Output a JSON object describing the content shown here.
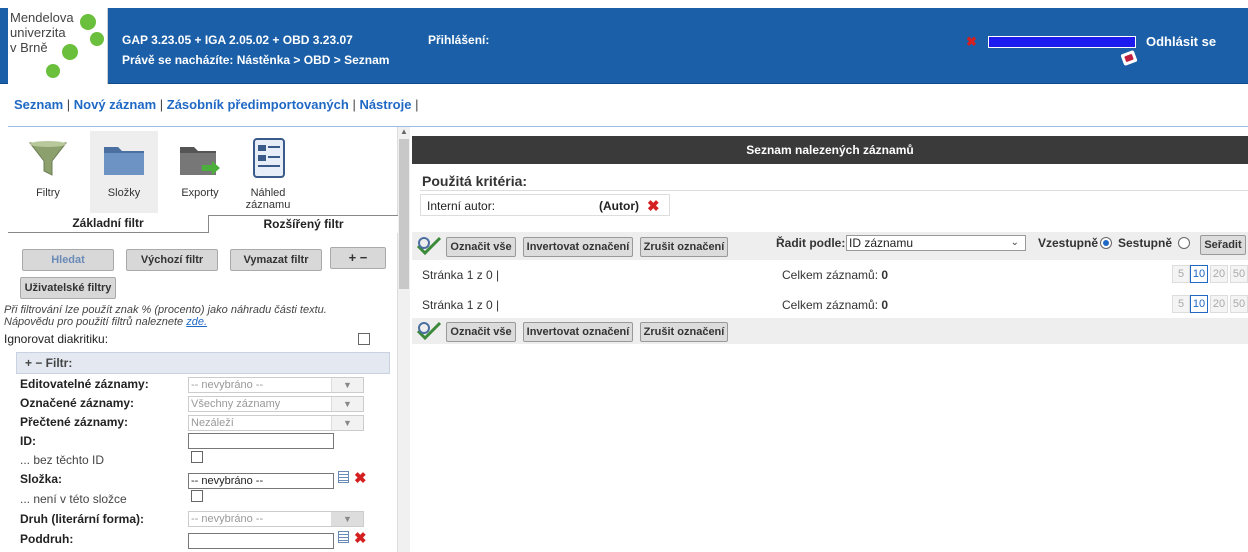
{
  "logo": {
    "lines": [
      "Mendelova",
      "univerzita",
      "v Brně"
    ]
  },
  "header": {
    "version": "GAP 3.23.05 + IGA 2.05.02 + OBD 3.23.07",
    "location": "Právě se nacházíte: Nástěnka >  OBD > Seznam",
    "login_label": "Přihlášení:",
    "logout": "Odhlásit se"
  },
  "nav": {
    "items": [
      "Seznam",
      "Nový záznam",
      "Zásobník předimportovaných",
      "Nástroje"
    ]
  },
  "tools": [
    {
      "label": "Filtry",
      "icon": "funnel-icon"
    },
    {
      "label": "Složky",
      "icon": "folder-icon"
    },
    {
      "label": "Exporty",
      "icon": "export-folder-icon"
    },
    {
      "label": "Náhled záznamu",
      "icon": "document-preview-icon"
    }
  ],
  "tabs": {
    "basic": "Základní filtr",
    "advanced": "Rozšířený filtr"
  },
  "buttons": {
    "search": "Hledat",
    "default_filter": "Výchozí filtr",
    "clear_filter": "Vymazat filtr",
    "plus_minus": "+ −",
    "user_filters": "Uživatelské filtry"
  },
  "hints": {
    "line1": "Při filtrování lze použít znak % (procento) jako náhradu části textu.",
    "line2": "Nápovědu pro použití filtrů naleznete",
    "link": "zde."
  },
  "ignore_diacritics": "Ignorovat diakritiku:",
  "filter_head": "+ −  Filtr:",
  "filters": {
    "editable": {
      "label": "Editovatelné záznamy:",
      "value": "-- nevybráno --"
    },
    "marked": {
      "label": "Označené záznamy:",
      "value": "Všechny záznamy"
    },
    "read": {
      "label": "Přečtené záznamy:",
      "value": "Nezáleží"
    },
    "id": {
      "label": "ID:",
      "value": ""
    },
    "without_ids": {
      "label": "... bez těchto ID"
    },
    "folder": {
      "label": "Složka:",
      "value": "-- nevybráno --"
    },
    "not_in_folder": {
      "label": "... není v této složce"
    },
    "kind": {
      "label": "Druh (literární forma):",
      "value": "-- nevybráno --"
    },
    "subkind": {
      "label": "Poddruh:",
      "value": ""
    }
  },
  "right": {
    "title": "Seznam nalezených záznamů",
    "criteria_title": "Použitá kritéria:",
    "criteria": {
      "field": "Interní autor:",
      "tag": "(Autor)"
    },
    "mark_all": "Označit vše",
    "invert": "Invertovat označení",
    "unmark": "Zrušit označení",
    "sort_label": "Řadit podle:",
    "sort_value": "ID záznamu",
    "asc": "Vzestupně",
    "desc": "Sestupně",
    "sort_button": "Seřadit",
    "page_info": "Stránka 1 z 0 |",
    "total_label": "Celkem záznamů:",
    "total_value": "0",
    "page_sizes": [
      "5",
      "10",
      "20",
      "50"
    ]
  }
}
